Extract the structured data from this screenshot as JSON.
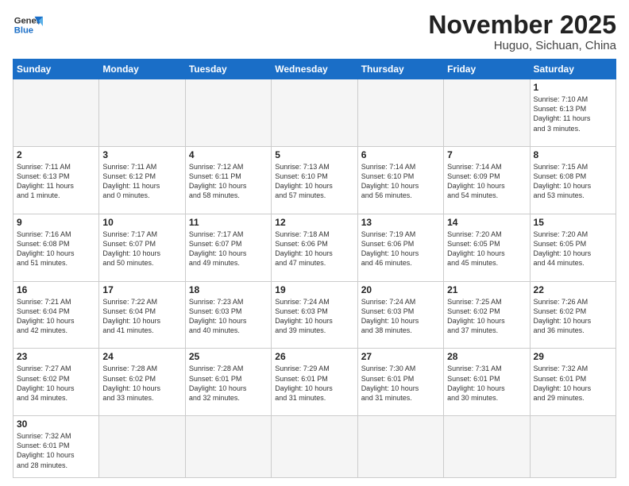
{
  "header": {
    "logo_general": "General",
    "logo_blue": "Blue",
    "month_title": "November 2025",
    "location": "Huguo, Sichuan, China"
  },
  "weekdays": [
    "Sunday",
    "Monday",
    "Tuesday",
    "Wednesday",
    "Thursday",
    "Friday",
    "Saturday"
  ],
  "weeks": [
    [
      {
        "day": "",
        "info": ""
      },
      {
        "day": "",
        "info": ""
      },
      {
        "day": "",
        "info": ""
      },
      {
        "day": "",
        "info": ""
      },
      {
        "day": "",
        "info": ""
      },
      {
        "day": "",
        "info": ""
      },
      {
        "day": "1",
        "info": "Sunrise: 7:10 AM\nSunset: 6:13 PM\nDaylight: 11 hours\nand 3 minutes."
      }
    ],
    [
      {
        "day": "2",
        "info": "Sunrise: 7:11 AM\nSunset: 6:13 PM\nDaylight: 11 hours\nand 1 minute."
      },
      {
        "day": "3",
        "info": "Sunrise: 7:11 AM\nSunset: 6:12 PM\nDaylight: 11 hours\nand 0 minutes."
      },
      {
        "day": "4",
        "info": "Sunrise: 7:12 AM\nSunset: 6:11 PM\nDaylight: 10 hours\nand 58 minutes."
      },
      {
        "day": "5",
        "info": "Sunrise: 7:13 AM\nSunset: 6:10 PM\nDaylight: 10 hours\nand 57 minutes."
      },
      {
        "day": "6",
        "info": "Sunrise: 7:14 AM\nSunset: 6:10 PM\nDaylight: 10 hours\nand 56 minutes."
      },
      {
        "day": "7",
        "info": "Sunrise: 7:14 AM\nSunset: 6:09 PM\nDaylight: 10 hours\nand 54 minutes."
      },
      {
        "day": "8",
        "info": "Sunrise: 7:15 AM\nSunset: 6:08 PM\nDaylight: 10 hours\nand 53 minutes."
      }
    ],
    [
      {
        "day": "9",
        "info": "Sunrise: 7:16 AM\nSunset: 6:08 PM\nDaylight: 10 hours\nand 51 minutes."
      },
      {
        "day": "10",
        "info": "Sunrise: 7:17 AM\nSunset: 6:07 PM\nDaylight: 10 hours\nand 50 minutes."
      },
      {
        "day": "11",
        "info": "Sunrise: 7:17 AM\nSunset: 6:07 PM\nDaylight: 10 hours\nand 49 minutes."
      },
      {
        "day": "12",
        "info": "Sunrise: 7:18 AM\nSunset: 6:06 PM\nDaylight: 10 hours\nand 47 minutes."
      },
      {
        "day": "13",
        "info": "Sunrise: 7:19 AM\nSunset: 6:06 PM\nDaylight: 10 hours\nand 46 minutes."
      },
      {
        "day": "14",
        "info": "Sunrise: 7:20 AM\nSunset: 6:05 PM\nDaylight: 10 hours\nand 45 minutes."
      },
      {
        "day": "15",
        "info": "Sunrise: 7:20 AM\nSunset: 6:05 PM\nDaylight: 10 hours\nand 44 minutes."
      }
    ],
    [
      {
        "day": "16",
        "info": "Sunrise: 7:21 AM\nSunset: 6:04 PM\nDaylight: 10 hours\nand 42 minutes."
      },
      {
        "day": "17",
        "info": "Sunrise: 7:22 AM\nSunset: 6:04 PM\nDaylight: 10 hours\nand 41 minutes."
      },
      {
        "day": "18",
        "info": "Sunrise: 7:23 AM\nSunset: 6:03 PM\nDaylight: 10 hours\nand 40 minutes."
      },
      {
        "day": "19",
        "info": "Sunrise: 7:24 AM\nSunset: 6:03 PM\nDaylight: 10 hours\nand 39 minutes."
      },
      {
        "day": "20",
        "info": "Sunrise: 7:24 AM\nSunset: 6:03 PM\nDaylight: 10 hours\nand 38 minutes."
      },
      {
        "day": "21",
        "info": "Sunrise: 7:25 AM\nSunset: 6:02 PM\nDaylight: 10 hours\nand 37 minutes."
      },
      {
        "day": "22",
        "info": "Sunrise: 7:26 AM\nSunset: 6:02 PM\nDaylight: 10 hours\nand 36 minutes."
      }
    ],
    [
      {
        "day": "23",
        "info": "Sunrise: 7:27 AM\nSunset: 6:02 PM\nDaylight: 10 hours\nand 34 minutes."
      },
      {
        "day": "24",
        "info": "Sunrise: 7:28 AM\nSunset: 6:02 PM\nDaylight: 10 hours\nand 33 minutes."
      },
      {
        "day": "25",
        "info": "Sunrise: 7:28 AM\nSunset: 6:01 PM\nDaylight: 10 hours\nand 32 minutes."
      },
      {
        "day": "26",
        "info": "Sunrise: 7:29 AM\nSunset: 6:01 PM\nDaylight: 10 hours\nand 31 minutes."
      },
      {
        "day": "27",
        "info": "Sunrise: 7:30 AM\nSunset: 6:01 PM\nDaylight: 10 hours\nand 31 minutes."
      },
      {
        "day": "28",
        "info": "Sunrise: 7:31 AM\nSunset: 6:01 PM\nDaylight: 10 hours\nand 30 minutes."
      },
      {
        "day": "29",
        "info": "Sunrise: 7:32 AM\nSunset: 6:01 PM\nDaylight: 10 hours\nand 29 minutes."
      }
    ],
    [
      {
        "day": "30",
        "info": "Sunrise: 7:32 AM\nSunset: 6:01 PM\nDaylight: 10 hours\nand 28 minutes."
      },
      {
        "day": "",
        "info": ""
      },
      {
        "day": "",
        "info": ""
      },
      {
        "day": "",
        "info": ""
      },
      {
        "day": "",
        "info": ""
      },
      {
        "day": "",
        "info": ""
      },
      {
        "day": "",
        "info": ""
      }
    ]
  ]
}
